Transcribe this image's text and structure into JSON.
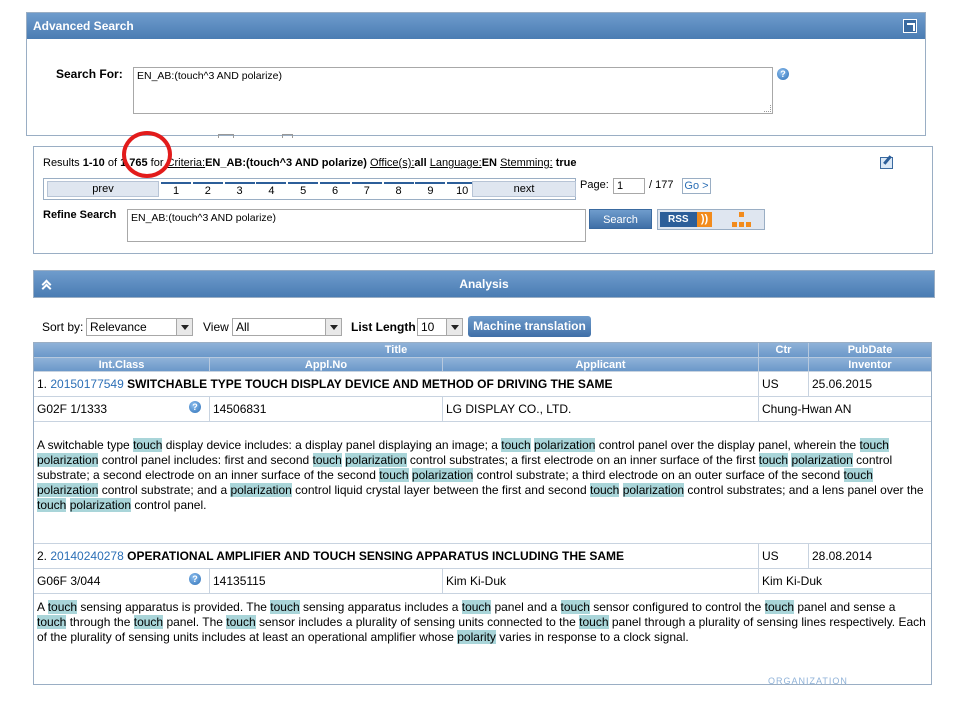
{
  "advanced_search": {
    "title": "Advanced Search",
    "search_for_label": "Search For:",
    "query": "EN_AB:(touch^3 AND polarize)"
  },
  "results_summary": {
    "prefix": "Results ",
    "range": "1-10",
    "of": " of ",
    "total": "1,765",
    "for": " for ",
    "criteria_label": "Criteria:",
    "criteria_value": "EN_AB:(touch^3 AND polarize)",
    "offices_label": "Office(s):",
    "offices_value": "all",
    "language_label": "Language:",
    "language_value": "EN",
    "stemming_label": "Stemming:",
    "stemming_value": " true"
  },
  "pager": {
    "prev": "prev",
    "next": "next",
    "pages": [
      "1",
      "2",
      "3",
      "4",
      "5",
      "6",
      "7",
      "8",
      "9",
      "10"
    ],
    "page_label": "Page:",
    "current_page": "1",
    "total_pages": "/ 177",
    "go": "Go >"
  },
  "refine": {
    "label": "Refine Search",
    "query": "EN_AB:(touch^3 AND polarize)",
    "search_button": "Search",
    "rss": "RSS"
  },
  "analysis": {
    "label": "Analysis"
  },
  "controls": {
    "sort_label": "Sort by:",
    "sort_value": "Relevance",
    "view_label": "View",
    "view_value": "All",
    "list_length_label": "List Length",
    "list_length_value": "10",
    "machine_translation": "Machine translation"
  },
  "table": {
    "headers_top": {
      "title": "Title",
      "ctr": "Ctr",
      "pubdate": "PubDate"
    },
    "headers_bottom": {
      "intclass": "Int.Class",
      "applno": "Appl.No",
      "applicant": "Applicant",
      "inventor": "Inventor"
    },
    "results": [
      {
        "num": "1.",
        "pubno": "20150177549",
        "title": "SWITCHABLE TYPE TOUCH DISPLAY DEVICE AND METHOD OF DRIVING THE SAME",
        "ctr": "US",
        "pubdate": "25.06.2015",
        "intclass": "G02F 1/1333",
        "applno": "14506831",
        "applicant": "LG DISPLAY CO., LTD.",
        "inventor": "Chung-Hwan AN",
        "abstract": [
          {
            "t": "A switchable type "
          },
          {
            "t": "touch",
            "h": true
          },
          {
            "t": " display device includes: a display panel displaying an image; a "
          },
          {
            "t": "touch",
            "h": true
          },
          {
            "t": " "
          },
          {
            "t": "polarization",
            "h": true
          },
          {
            "t": " control panel over the display panel, wherein the "
          },
          {
            "t": "touch",
            "h": true
          },
          {
            "t": " "
          },
          {
            "t": "polarization",
            "h": true
          },
          {
            "t": " control panel includes: first and second "
          },
          {
            "t": "touch",
            "h": true
          },
          {
            "t": " "
          },
          {
            "t": "polarization",
            "h": true
          },
          {
            "t": " control substrates; a first electrode on an inner surface of the first "
          },
          {
            "t": "touch",
            "h": true
          },
          {
            "t": " "
          },
          {
            "t": "polarization",
            "h": true
          },
          {
            "t": " control substrate; a second electrode on an inner surface of the second "
          },
          {
            "t": "touch",
            "h": true
          },
          {
            "t": " "
          },
          {
            "t": "polarization",
            "h": true
          },
          {
            "t": " control substrate; a third electrode on an outer surface of the second "
          },
          {
            "t": "touch",
            "h": true
          },
          {
            "t": " "
          },
          {
            "t": "polarization",
            "h": true
          },
          {
            "t": " control substrate; and a "
          },
          {
            "t": "polarization",
            "h": true
          },
          {
            "t": " control liquid crystal layer between the first and second "
          },
          {
            "t": "touch",
            "h": true
          },
          {
            "t": " "
          },
          {
            "t": "polarization",
            "h": true
          },
          {
            "t": " control substrates; and a lens panel over the "
          },
          {
            "t": "touch",
            "h": true
          },
          {
            "t": " "
          },
          {
            "t": "polarization",
            "h": true
          },
          {
            "t": " control panel."
          }
        ]
      },
      {
        "num": "2.",
        "pubno": "20140240278",
        "title": "OPERATIONAL AMPLIFIER AND TOUCH SENSING APPARATUS INCLUDING THE SAME",
        "ctr": "US",
        "pubdate": "28.08.2014",
        "intclass": "G06F 3/044",
        "applno": "14135115",
        "applicant": "Kim Ki-Duk",
        "inventor": "Kim Ki-Duk",
        "abstract": [
          {
            "t": "A "
          },
          {
            "t": "touch",
            "h": true
          },
          {
            "t": " sensing apparatus is provided. The "
          },
          {
            "t": "touch",
            "h": true
          },
          {
            "t": " sensing apparatus includes a "
          },
          {
            "t": "touch",
            "h": true
          },
          {
            "t": " panel and a "
          },
          {
            "t": "touch",
            "h": true
          },
          {
            "t": " sensor configured to control the "
          },
          {
            "t": "touch",
            "h": true
          },
          {
            "t": " panel and sense a "
          },
          {
            "t": "touch",
            "h": true
          },
          {
            "t": " through the "
          },
          {
            "t": "touch",
            "h": true
          },
          {
            "t": " panel. The "
          },
          {
            "t": "touch",
            "h": true
          },
          {
            "t": " sensor includes a plurality of sensing units connected to the "
          },
          {
            "t": "touch",
            "h": true
          },
          {
            "t": " panel through a plurality of sensing lines respectively. Each of the plurality of sensing units includes at least an operational amplifier whose "
          },
          {
            "t": "polarity",
            "h": true
          },
          {
            "t": " varies in response to a clock signal."
          }
        ]
      }
    ]
  },
  "footer_partial": {
    "org_text": "ORGANIZATION"
  },
  "colors": {
    "accent": "#4a7cb3",
    "highlight": "#a9d5d9",
    "annotation": "#e21b1b",
    "link": "#2c6fb6"
  }
}
